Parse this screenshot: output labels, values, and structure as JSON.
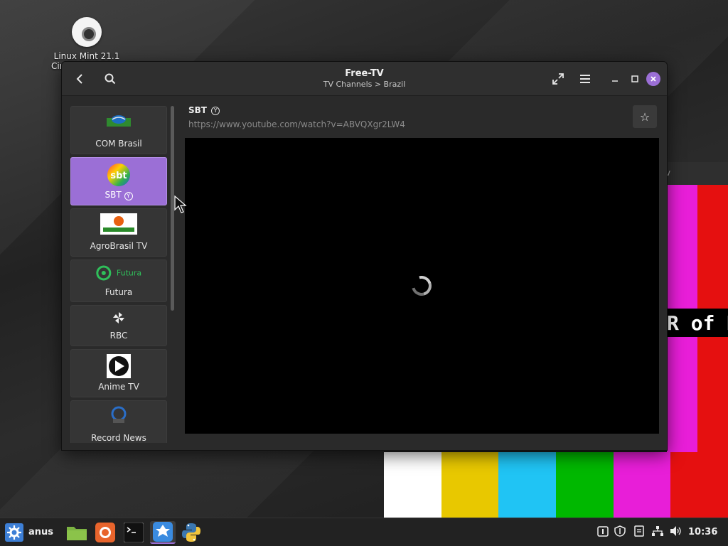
{
  "desktop": {
    "icon_label_line1": "Linux Mint 21.1",
    "icon_label_line2": "Cin"
  },
  "background_window": {
    "title": "v",
    "overlay_text": "R of K",
    "bar_colors": [
      "#ffffff",
      "#e8c800",
      "#20c4f4",
      "#00b800",
      "#e81ed8",
      "#e51010"
    ]
  },
  "window": {
    "title": "Free-TV",
    "subtitle": "TV Channels > Brazil",
    "accent": "#9b6fd6",
    "close_symbol": "✕",
    "back_symbol": "‹",
    "fullscreen_symbol": "⤢",
    "menu_symbol": "☰",
    "minimize_symbol": "–",
    "maximize_symbol": "□"
  },
  "channels": [
    {
      "name": "COM Brasil",
      "logo": "com-brasil-logo",
      "active": false
    },
    {
      "name": "SBT",
      "badge": "Y",
      "logo": "sbt-logo",
      "active": true
    },
    {
      "name": "AgroBrasil TV",
      "logo": "agrobrasil-logo",
      "active": false
    },
    {
      "name": "Futura",
      "logo": "futura-logo",
      "logo_text": "Futura",
      "active": false
    },
    {
      "name": "RBC",
      "logo": "rbc-logo",
      "active": false
    },
    {
      "name": "Anime TV",
      "logo": "anime-tv-logo",
      "active": false
    },
    {
      "name": "Record News",
      "logo": "record-news-logo",
      "active": false
    }
  ],
  "content": {
    "channel_title": "SBT",
    "channel_badge": "Y",
    "url": "https://www.youtube.com/watch?v=ABVQXgr2LW4",
    "star_symbol": "☆",
    "status": "loading"
  },
  "taskbar": {
    "menu_label": "anus",
    "clock": "10:36",
    "launchers": [
      "menu-icon",
      "files-icon",
      "firefox-icon",
      "terminal-icon",
      "free-tv-icon",
      "python-icon"
    ],
    "tray_icons": [
      "update-icon",
      "shield-icon",
      "notes-icon",
      "network-icon",
      "volume-icon"
    ]
  }
}
